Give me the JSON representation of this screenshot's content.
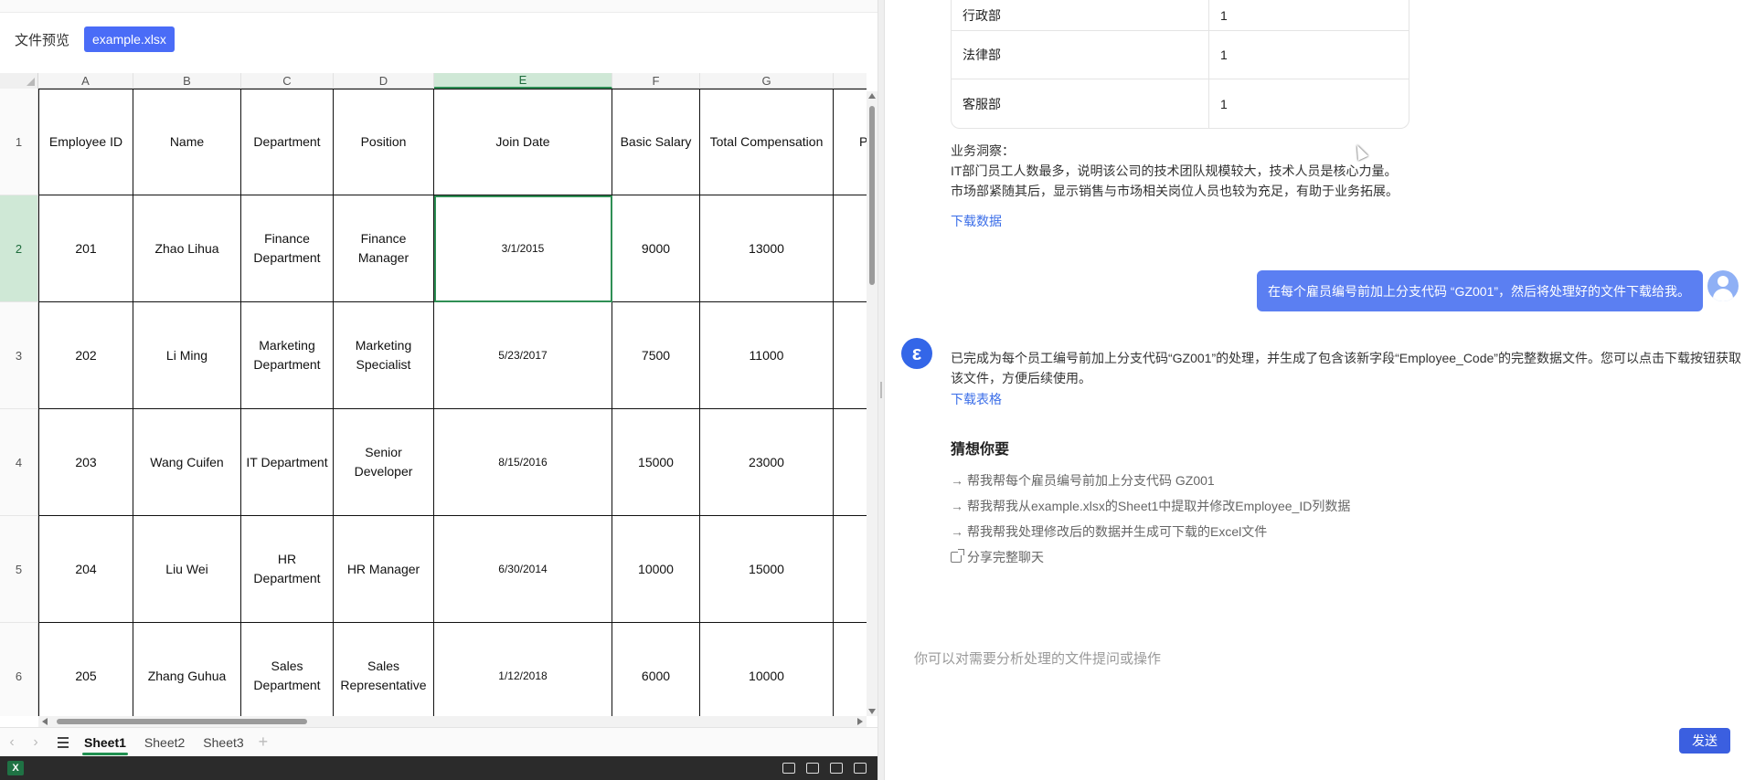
{
  "preview": {
    "label": "文件预览",
    "filename": "example.xlsx"
  },
  "sheet": {
    "columns": [
      "A",
      "B",
      "C",
      "D",
      "E",
      "F",
      "G"
    ],
    "rows": [
      "1",
      "2",
      "3",
      "4",
      "5",
      "6"
    ],
    "header": [
      "Employee ID",
      "Name",
      "Department",
      "Position",
      "Join Date",
      "Basic Salary",
      "Total Compensation",
      "P"
    ],
    "data": [
      [
        "201",
        "Zhao Lihua",
        "Finance Department",
        "Finance Manager",
        "3/1/2015",
        "9000",
        "13000"
      ],
      [
        "202",
        "Li Ming",
        "Marketing Department",
        "Marketing Specialist",
        "5/23/2017",
        "7500",
        "11000"
      ],
      [
        "203",
        "Wang Cuifen",
        "IT Department",
        "Senior Developer",
        "8/15/2016",
        "15000",
        "23000"
      ],
      [
        "204",
        "Liu Wei",
        "HR Department",
        "HR Manager",
        "6/30/2014",
        "10000",
        "15000"
      ],
      [
        "205",
        "Zhang Guhua",
        "Sales Department",
        "Sales Representative",
        "1/12/2018",
        "6000",
        "10000"
      ]
    ],
    "tabs": [
      "Sheet1",
      "Sheet2",
      "Sheet3"
    ],
    "add_tab": "+"
  },
  "chat": {
    "dept_table": [
      {
        "dept": "行政部",
        "count": "1"
      },
      {
        "dept": "法律部",
        "count": "1"
      },
      {
        "dept": "客服部",
        "count": "1"
      }
    ],
    "insight_title": "业务洞察：",
    "insight_line1": "IT部门员工人数最多，说明该公司的技术团队规模较大，技术人员是核心力量。",
    "insight_line2": "市场部紧随其后，显示销售与市场相关岗位人员也较为充足，有助于业务拓展。",
    "download_data": "下载数据",
    "user_message": "在每个雇员编号前加上分支代码 “GZ001”，然后将处理好的文件下载给我。",
    "bot_message": "已完成为每个员工编号前加上分支代码“GZ001”的处理，并生成了包含该新字段“Employee_Code”的完整数据文件。您可以点击下载按钮获取该文件，方便后续使用。",
    "download_table": "下载表格",
    "suggest_title": "猜想你要",
    "suggestions": [
      "帮我帮每个雇员编号前加上分支代码 GZ001",
      "帮我帮我从example.xlsx的Sheet1中提取并修改Employee_ID列数据",
      "帮我帮我处理修改后的数据并生成可下载的Excel文件"
    ],
    "share": "分享完整聊天",
    "input_placeholder": "你可以对需要分析处理的文件提问或操作",
    "send": "发送",
    "bot_avatar_glyph": "ε",
    "suggest_arrow": "→"
  },
  "status": {
    "app_icon": "X"
  }
}
